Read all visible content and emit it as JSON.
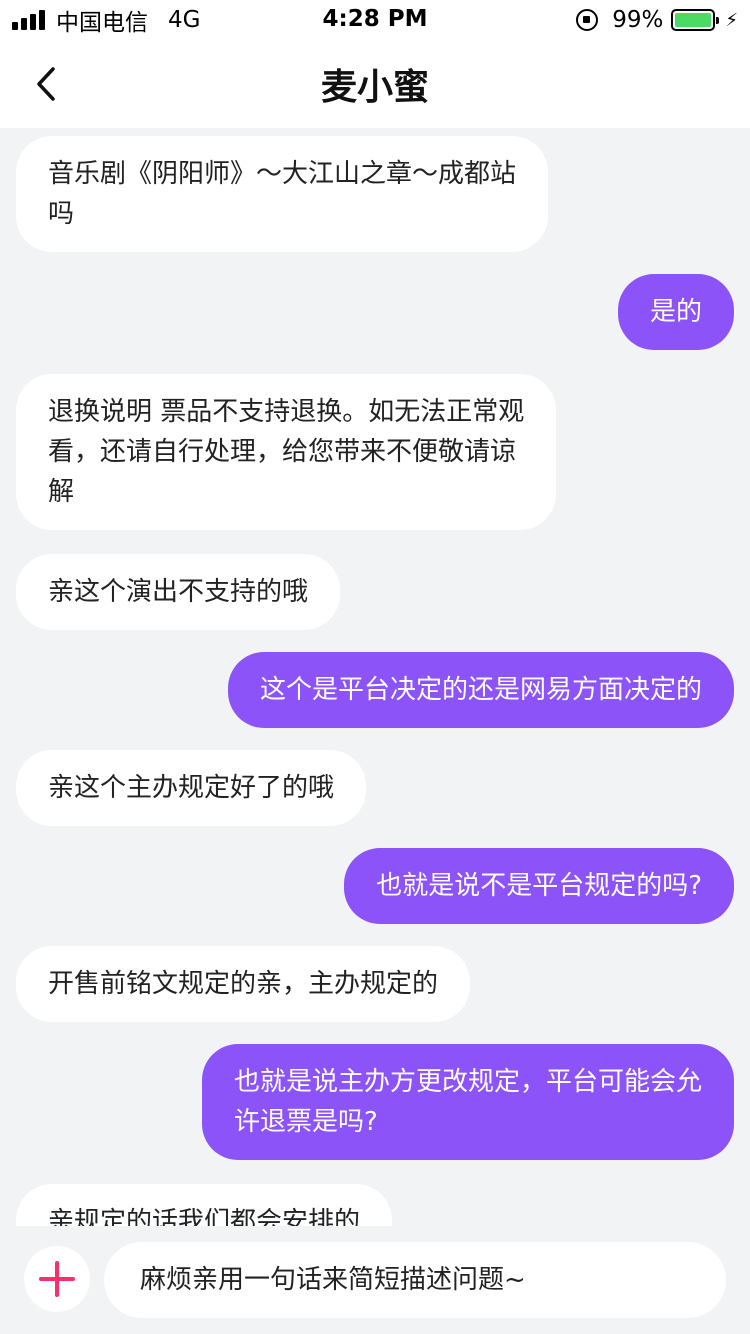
{
  "status_bar": {
    "carrier": "中国电信",
    "network": "4G",
    "time": "4:28 PM",
    "battery_percent": "99%",
    "battery_level": 0.99,
    "battery_color": "#4cd964"
  },
  "nav": {
    "title": "麦小蜜",
    "back_icon": "chevron-left-icon"
  },
  "colors": {
    "accent": "#8c53f9",
    "plus_icon": "#ff2d6a",
    "background": "#f2f3f5"
  },
  "messages": [
    {
      "side": "left",
      "lines": [
        "音乐剧《阴阳师》～大江山之章～成都站",
        "吗"
      ]
    },
    {
      "side": "right",
      "lines": [
        "是的"
      ]
    },
    {
      "side": "left",
      "lines": [
        "退换说明 票品不支持退换。如无法正常观",
        "看，还请自行处理，给您带来不便敬请谅",
        "解"
      ]
    },
    {
      "side": "left",
      "lines": [
        "亲这个演出不支持的哦"
      ]
    },
    {
      "side": "right",
      "lines": [
        "这个是平台决定的还是网易方面决定的"
      ]
    },
    {
      "side": "left",
      "lines": [
        "亲这个主办规定好了的哦"
      ]
    },
    {
      "side": "right",
      "lines": [
        "也就是说不是平台规定的吗?"
      ]
    },
    {
      "side": "left",
      "lines": [
        "开售前铭文规定的亲，主办规定的"
      ]
    },
    {
      "side": "right",
      "lines": [
        "也就是说主办方更改规定，平台可能会允",
        "许退票是吗?"
      ]
    },
    {
      "side": "left",
      "lines": [
        "亲规定的话我们都会安排的"
      ]
    }
  ],
  "input": {
    "placeholder": "麻烦亲用一句话来简短描述问题~",
    "plus_icon": "plus-icon"
  }
}
